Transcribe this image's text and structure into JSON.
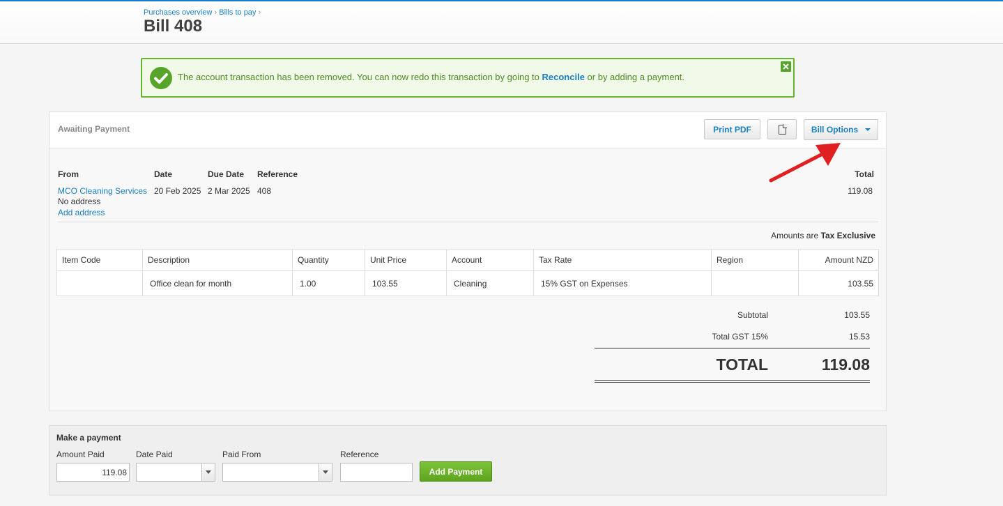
{
  "breadcrumb": {
    "items": [
      "Purchases overview",
      "Bills to pay"
    ],
    "separator": "›"
  },
  "page_title": "Bill 408",
  "notice": {
    "text_before": "The account transaction has been removed. You can now redo this transaction by going to ",
    "link": "Reconcile",
    "text_after": " or by adding a payment.",
    "icons": [
      "check-circle-icon",
      "close-icon"
    ]
  },
  "bill": {
    "status": "Awaiting Payment",
    "buttons": {
      "print": "Print PDF",
      "copy_icon": "copy-document-icon",
      "options": "Bill Options"
    },
    "labels": {
      "from": "From",
      "date": "Date",
      "due_date": "Due Date",
      "reference": "Reference",
      "total": "Total"
    },
    "from": {
      "name": "MCO Cleaning Services",
      "address": "No address",
      "add_address": "Add address"
    },
    "date": "20 Feb 2025",
    "due_date": "2 Mar 2025",
    "reference": "408",
    "total": "119.08",
    "amounts_note": {
      "prefix": "Amounts are",
      "mode": "Tax Exclusive"
    },
    "table": {
      "headers": [
        "Item Code",
        "Description",
        "Quantity",
        "Unit Price",
        "Account",
        "Tax Rate",
        "Region",
        "Amount NZD"
      ],
      "rows": [
        [
          "",
          "Office clean for month",
          "1.00",
          "103.55",
          "Cleaning",
          "15% GST on Expenses",
          "",
          "103.55"
        ]
      ]
    },
    "totals": {
      "subtotal_label": "Subtotal",
      "subtotal": "103.55",
      "gst_label": "Total GST  15%",
      "gst": "15.53",
      "total_label": "TOTAL",
      "total": "119.08"
    }
  },
  "payment": {
    "title": "Make a payment",
    "amount_label": "Amount Paid",
    "amount_value": "119.08",
    "date_label": "Date Paid",
    "date_value": "",
    "from_label": "Paid From",
    "from_value": "",
    "reference_label": "Reference",
    "reference_value": "",
    "button": "Add Payment"
  },
  "colors": {
    "accent": "#1a7fc1",
    "success": "#56a52a",
    "annotation_arrow": "#e02020"
  }
}
